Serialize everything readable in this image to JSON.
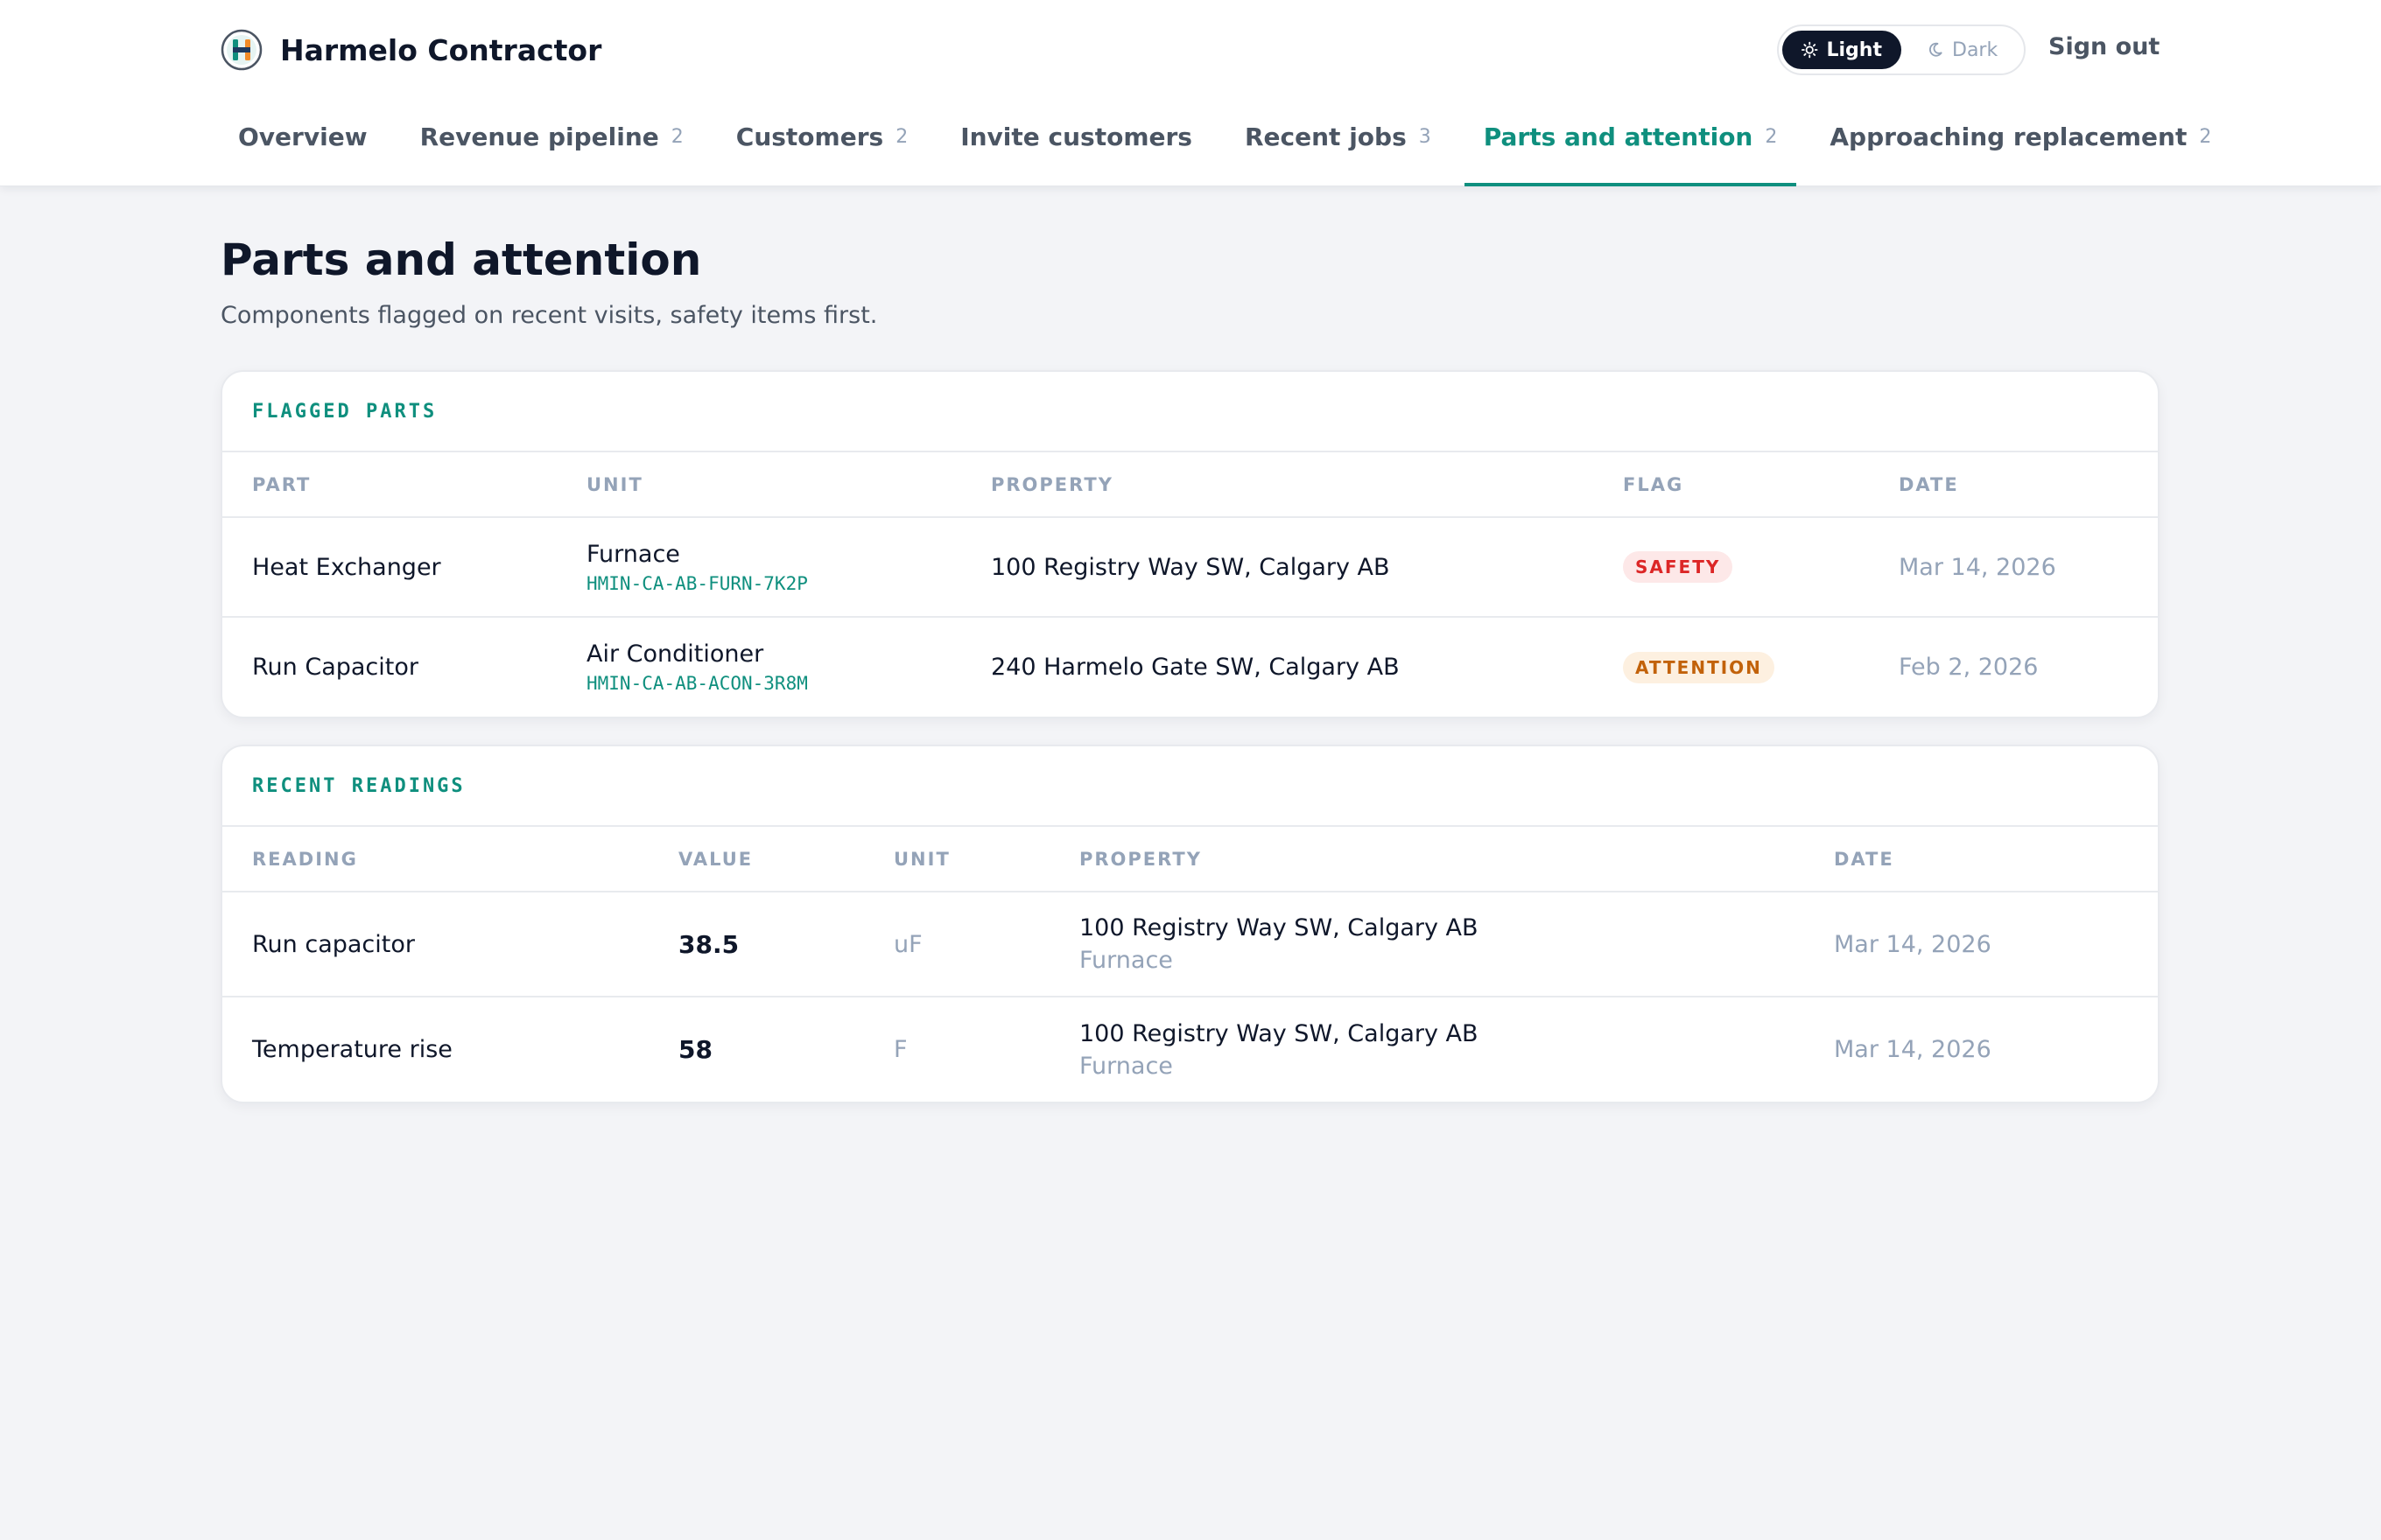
{
  "app": {
    "title": "Harmelo Contractor"
  },
  "header": {
    "theme": {
      "light_label": "Light",
      "dark_label": "Dark",
      "selected": "Light"
    },
    "sign_out_label": "Sign out"
  },
  "nav": {
    "tabs": [
      {
        "label": "Overview",
        "count": ""
      },
      {
        "label": "Revenue pipeline",
        "count": "2"
      },
      {
        "label": "Customers",
        "count": "2"
      },
      {
        "label": "Invite customers",
        "count": ""
      },
      {
        "label": "Recent jobs",
        "count": "3"
      },
      {
        "label": "Parts and attention",
        "count": "2",
        "active": true
      },
      {
        "label": "Approaching replacement",
        "count": "2"
      }
    ]
  },
  "page": {
    "title": "Parts and attention",
    "subtitle": "Components flagged on recent visits, safety items first."
  },
  "flagged_parts": {
    "title": "FLAGGED PARTS",
    "columns": [
      "PART",
      "UNIT",
      "PROPERTY",
      "FLAG",
      "DATE"
    ],
    "rows": [
      {
        "part": "Heat Exchanger",
        "unit": "Furnace",
        "unit_code": "HMIN-CA-AB-FURN-7K2P",
        "property": "100 Registry Way SW, Calgary AB",
        "flag": "SAFETY",
        "date": "Mar 14, 2026"
      },
      {
        "part": "Run Capacitor",
        "unit": "Air Conditioner",
        "unit_code": "HMIN-CA-AB-ACON-3R8M",
        "property": "240 Harmelo Gate SW, Calgary AB",
        "flag": "ATTENTION",
        "date": "Feb 2, 2026"
      }
    ]
  },
  "recent_readings": {
    "title": "RECENT READINGS",
    "columns": [
      "READING",
      "VALUE",
      "UNIT",
      "PROPERTY",
      "DATE"
    ],
    "rows": [
      {
        "reading": "Run capacitor",
        "value": "38.5",
        "unit": "uF",
        "property": "100 Registry Way SW, Calgary AB",
        "equipment": "Furnace",
        "date": "Mar 14, 2026"
      },
      {
        "reading": "Temperature rise",
        "value": "58",
        "unit": "F",
        "property": "100 Registry Way SW, Calgary AB",
        "equipment": "Furnace",
        "date": "Mar 14, 2026"
      }
    ]
  },
  "colors": {
    "accent": "#0f8f7e",
    "safety": "#dc2626",
    "attention": "#c2620a",
    "background": "#f3f4f7"
  }
}
